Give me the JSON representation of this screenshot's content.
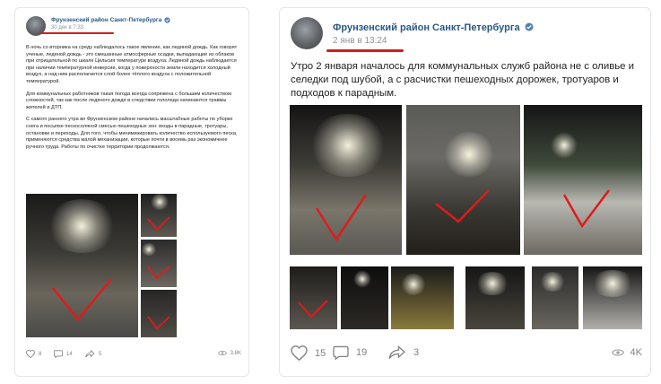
{
  "left_post": {
    "author": "Фрунзенский район Санкт-Петербурга",
    "date": "30 дек в 7:33",
    "paragraphs": [
      "В ночь со вторника на среду наблюдалось такое явление, как ледяной дождь. Как говорят ученые, ледяной дождь - это смешанные атмосферные осадки, выпадающие из облаков при отрицательной по шкале Цельсия температуре воздуха. Ледяной дождь наблюдается при наличии температурной инверсии, когда у поверхности земли находится холодный воздух, а над ним располагается слой более тёплого воздуха с положительной температурой.",
      "Для коммунальных работников такая погода всегда сопряжена с большим количеством сложностей, так как после ледяного дождя в следствии гололеда начинаются травмы жителей и ДТП.",
      "С самого раннего утра во Фрунзенском районе начались масштабные работы по уборке снега и посыпке пескосоляной смесью пешеходных зон: входы в парадные, тротуары, остановки и переходы. Для того, чтобы минимизировать количество используемого песка, применяются средства малой механизации, которые почти в восемь раз экономичнее ручного труда. Работы по очистке территории продолжаются."
    ],
    "likes": "8",
    "comments": "14",
    "shares": "5",
    "views": "3,8K"
  },
  "right_post": {
    "author": "Фрунзенский район Санкт-Петербурга",
    "date": "2 янв в 13:24",
    "text": "Утро 2 января началось для коммунальных служб района не с оливье и селедки под шубой, а с расчистки пешеходных дорожек, тротуаров и подходов к парадным.",
    "likes": "15",
    "comments": "19",
    "shares": "3",
    "views": "4K"
  },
  "colors": {
    "link": "#2a5885",
    "muted": "#939393",
    "highlight": "#d11d1d"
  },
  "icons": [
    "verified-icon",
    "heart-icon",
    "comment-icon",
    "share-icon",
    "eye-icon"
  ]
}
